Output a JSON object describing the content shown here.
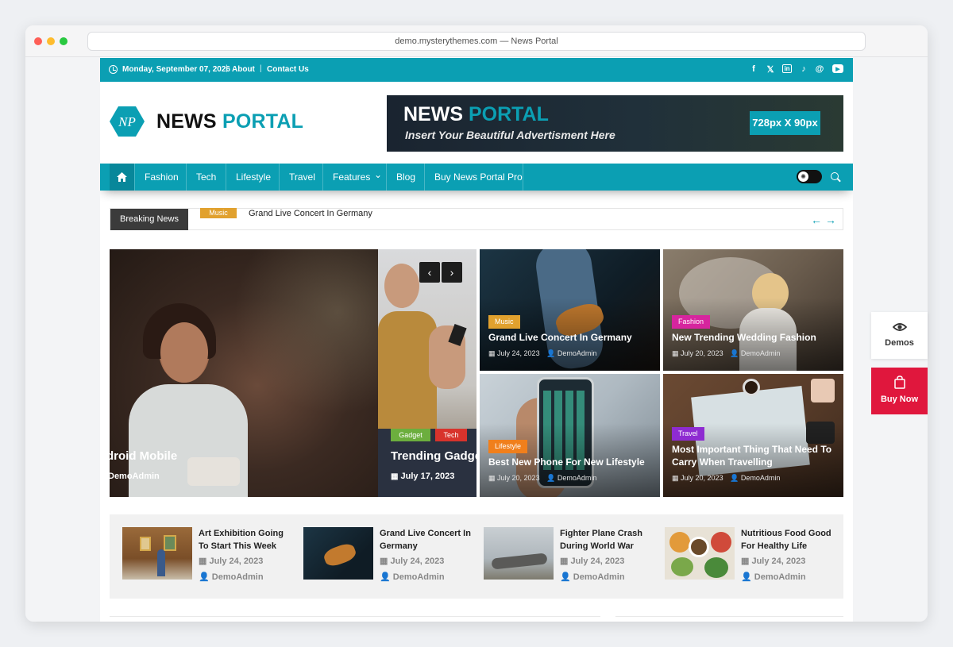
{
  "browser": {
    "url_title": "demo.mysterythemes.com — News Portal"
  },
  "topbar": {
    "date": "Monday, September 07, 2026",
    "links": [
      "About",
      "Contact Us"
    ],
    "social_icons": [
      "facebook-icon",
      "x-icon",
      "linkedin-icon",
      "tiktok-icon",
      "threads-icon",
      "youtube-icon"
    ],
    "social_glyphs": [
      "f",
      "𝕏",
      "in",
      "♪",
      "@",
      "▶"
    ]
  },
  "logo": {
    "mark": "NP",
    "word1": "NEWS",
    "word2": "PORTAL"
  },
  "ad": {
    "title1": "NEWS",
    "title2": "PORTAL",
    "subtitle": "Insert Your Beautiful Advertisment Here",
    "size": "728px X 90px"
  },
  "nav": {
    "items": [
      "Fashion",
      "Tech",
      "Lifestyle",
      "Travel",
      "Features",
      "Blog",
      "Buy News Portal Pro"
    ],
    "dropdown_glyph": "⌄"
  },
  "ticker": {
    "label": "Breaking News",
    "category": "Music",
    "headline": "Grand Live Concert In Germany",
    "prev": "←",
    "next": "→"
  },
  "slider": {
    "slide_a": {
      "title": "droid Mobile",
      "author": "DemoAdmin"
    },
    "slide_b": {
      "categories": [
        "Gadget",
        "Tech"
      ],
      "title": "Trending Gadge",
      "date": "July 17, 2023"
    },
    "prev": "‹",
    "next": "›"
  },
  "cards": [
    {
      "category": "Music",
      "title": "Grand Live Concert In Germany",
      "date": "July 24, 2023",
      "author": "DemoAdmin"
    },
    {
      "category": "Fashion",
      "title": "New Trending Wedding Fashion",
      "date": "July 20, 2023",
      "author": "DemoAdmin"
    },
    {
      "category": "Lifestyle",
      "title": "Best New Phone For New Lifestyle",
      "date": "July 20, 2023",
      "author": "DemoAdmin"
    },
    {
      "category": "Travel",
      "title": "Most Important Thing That Need To Carry When Travelling",
      "date": "July 20, 2023",
      "author": "DemoAdmin"
    }
  ],
  "latest": [
    {
      "title": "Art Exhibition Going To Start This Week",
      "date": "July 24, 2023",
      "author": "DemoAdmin"
    },
    {
      "title": "Grand Live Concert In Germany",
      "date": "July 24, 2023",
      "author": "DemoAdmin"
    },
    {
      "title": "Fighter Plane Crash During World War",
      "date": "July 24, 2023",
      "author": "DemoAdmin"
    },
    {
      "title": "Nutritious Food Good For Healthy Life",
      "date": "July 24, 2023",
      "author": "DemoAdmin"
    }
  ],
  "side": {
    "demos": "Demos",
    "buy": "Buy Now"
  },
  "colors": {
    "accent": "#0b9fb3",
    "music": "#e1a12e",
    "fashion": "#d6259e",
    "lifestyle": "#f07f1c",
    "travel": "#8e2bd1",
    "gadget": "#6cae3e",
    "tech": "#d8332c",
    "buy": "#e0173d"
  }
}
